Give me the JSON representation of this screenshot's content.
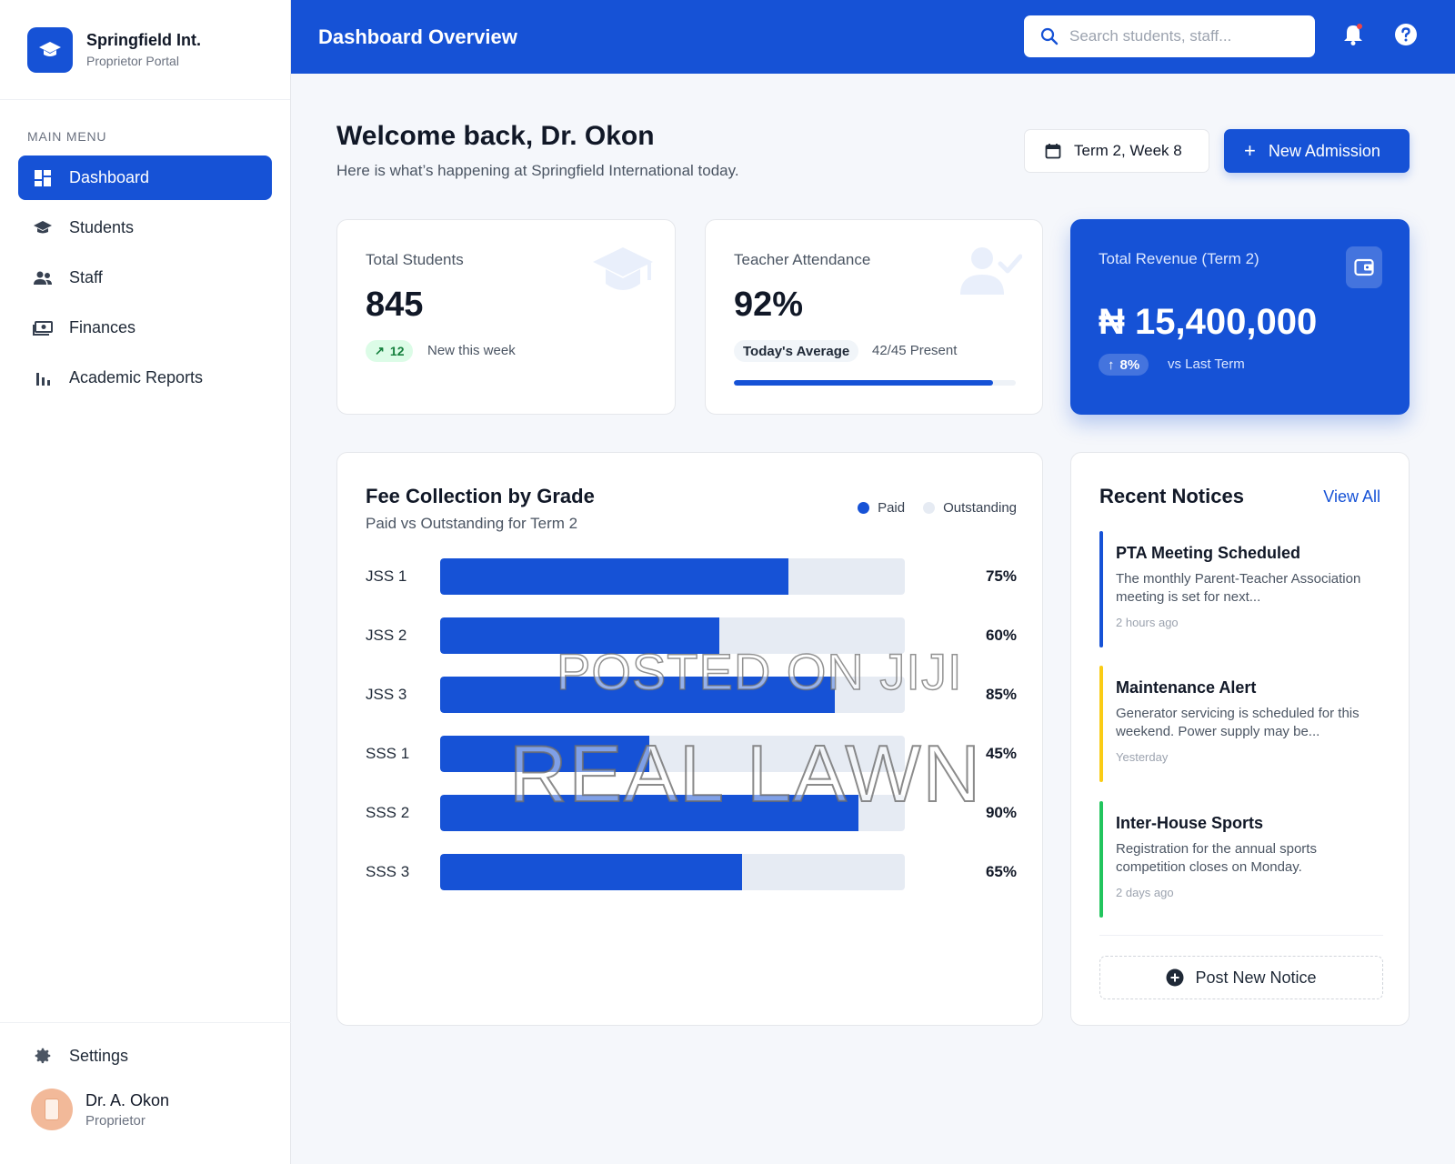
{
  "brand": {
    "name": "Springfield Int.",
    "subtitle": "Proprietor Portal"
  },
  "sidebar": {
    "menu_label": "MAIN MENU",
    "items": [
      {
        "label": "Dashboard",
        "icon": "dashboard-icon",
        "active": true
      },
      {
        "label": "Students",
        "icon": "graduation-cap-icon"
      },
      {
        "label": "Staff",
        "icon": "people-icon"
      },
      {
        "label": "Finances",
        "icon": "money-icon"
      },
      {
        "label": "Academic Reports",
        "icon": "bar-chart-icon"
      }
    ],
    "settings_label": "Settings",
    "user": {
      "name": "Dr. A. Okon",
      "role": "Proprietor"
    }
  },
  "header": {
    "title": "Dashboard Overview",
    "search_placeholder": "Search students, staff..."
  },
  "welcome": {
    "title": "Welcome back, Dr. Okon",
    "subtitle": "Here is what’s happening at Springfield International today.",
    "term_label": "Term 2, Week 8",
    "new_admission_label": "New Admission"
  },
  "stats": {
    "students": {
      "label": "Total Students",
      "value": "845",
      "trend_value": "12",
      "trend_text": "New this week"
    },
    "attendance": {
      "label": "Teacher Attendance",
      "value": "92%",
      "badge": "Today's Average",
      "present": "42/45 Present",
      "progress": 0.92
    },
    "revenue": {
      "label": "Total Revenue (Term 2)",
      "value": "₦ 15,400,000",
      "trend_value": "8%",
      "trend_text": "vs Last Term"
    }
  },
  "fee_chart": {
    "title": "Fee Collection by Grade",
    "subtitle": "Paid vs Outstanding for Term 2",
    "legend_paid": "Paid",
    "legend_outstanding": "Outstanding",
    "colors": {
      "paid": "#1652d6",
      "outstanding": "#e6ebf3"
    },
    "rows": [
      {
        "label": "JSS 1",
        "value_text": "75%"
      },
      {
        "label": "JSS 2",
        "value_text": "60%"
      },
      {
        "label": "JSS 3",
        "value_text": "85%"
      },
      {
        "label": "SSS 1",
        "value_text": "45%"
      },
      {
        "label": "SSS 2",
        "value_text": "90%"
      },
      {
        "label": "SSS 3",
        "value_text": "65%"
      }
    ]
  },
  "chart_data": {
    "type": "bar",
    "categories": [
      "JSS 1",
      "JSS 2",
      "JSS 3",
      "SSS 1",
      "SSS 2",
      "SSS 3"
    ],
    "values": [
      75,
      60,
      85,
      45,
      90,
      65
    ],
    "title": "Fee Collection by Grade",
    "subtitle": "Paid vs Outstanding for Term 2",
    "xlabel": "",
    "ylabel": "",
    "ylim": [
      0,
      100
    ]
  },
  "notices": {
    "title": "Recent Notices",
    "view_all": "View All",
    "items": [
      {
        "title": "PTA Meeting Scheduled",
        "body": "The monthly Parent-Teacher Association meeting is set for next...",
        "time": "2 hours ago",
        "color": "#1652d6"
      },
      {
        "title": "Maintenance Alert",
        "body": "Generator servicing is scheduled for this weekend. Power supply may be...",
        "time": "Yesterday",
        "color": "#facc15"
      },
      {
        "title": "Inter-House Sports",
        "body": "Registration for the annual sports competition closes on Monday.",
        "time": "2 days ago",
        "color": "#22c55e"
      }
    ],
    "post_label": "Post New Notice"
  },
  "watermark": {
    "line1": "POSTED ON JIJI",
    "line2": "REAL LAWN"
  }
}
